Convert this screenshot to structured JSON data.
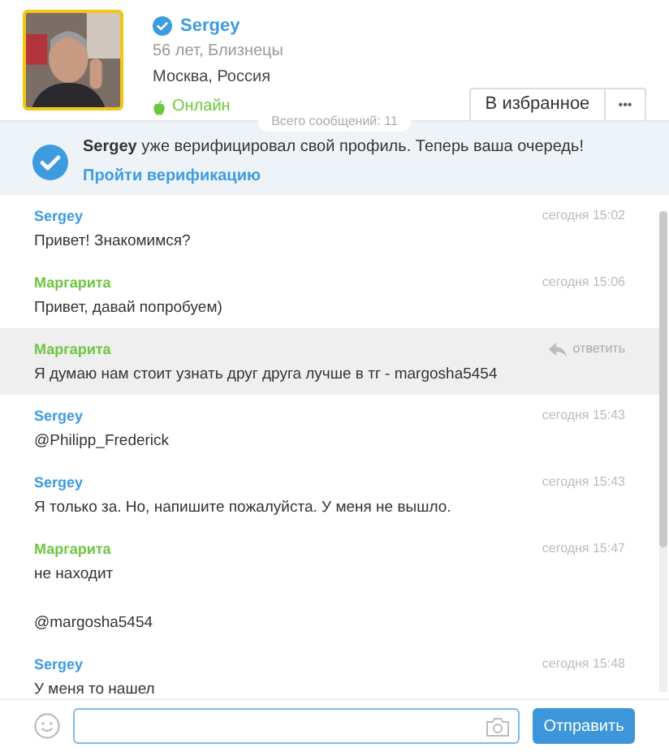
{
  "profile": {
    "name": "Sergey",
    "verified": true,
    "age_sign": "56 лет, Близнецы",
    "location": "Москва, Россия",
    "status": "Онлайн",
    "online": true,
    "favorite_button": "В избранное",
    "more_button": "•••"
  },
  "total_messages": "Всего сообщений: 11",
  "verification_banner": {
    "text": "**Sergey** уже верифицировал свой профиль. Теперь ваша очередь!",
    "link": "Пройти верификацию"
  },
  "messages": [
    {
      "author": "Sergey",
      "color": "#3d9be0",
      "time": "сегодня 15:02",
      "paragraphs": [
        "Привет! Знакомимся?"
      ],
      "highlighted": false
    },
    {
      "author": "Маргарита",
      "color": "#6cc63f",
      "time": "сегодня 15:06",
      "paragraphs": [
        "Привет, давай попробуем)"
      ],
      "highlighted": false
    },
    {
      "author": "Маргарита",
      "color": "#6cc63f",
      "reply": "ответить",
      "paragraphs": [
        "Я думаю нам стоит узнать друг друга лучше в тг - margosha5454"
      ],
      "highlighted": true
    },
    {
      "author": "Sergey",
      "color": "#3d9be0",
      "time": "сегодня 15:43",
      "paragraphs": [
        "@Philipp_Frederick"
      ],
      "highlighted": false
    },
    {
      "author": "Sergey",
      "color": "#3d9be0",
      "time": "сегодня 15:43",
      "paragraphs": [
        "Я только за. Но, напишите пожалуйста. У меня не вышло."
      ],
      "highlighted": false
    },
    {
      "author": "Маргарита",
      "color": "#6cc63f",
      "time": "сегодня 15:47",
      "paragraphs": [
        "не находит",
        "@margosha5454"
      ],
      "highlighted": false
    },
    {
      "author": "Sergey",
      "color": "#3d9be0",
      "time": "сегодня 15:48",
      "paragraphs": [
        "У меня то нашел"
      ],
      "highlighted": false
    }
  ],
  "composer": {
    "send_button": "Отправить"
  }
}
